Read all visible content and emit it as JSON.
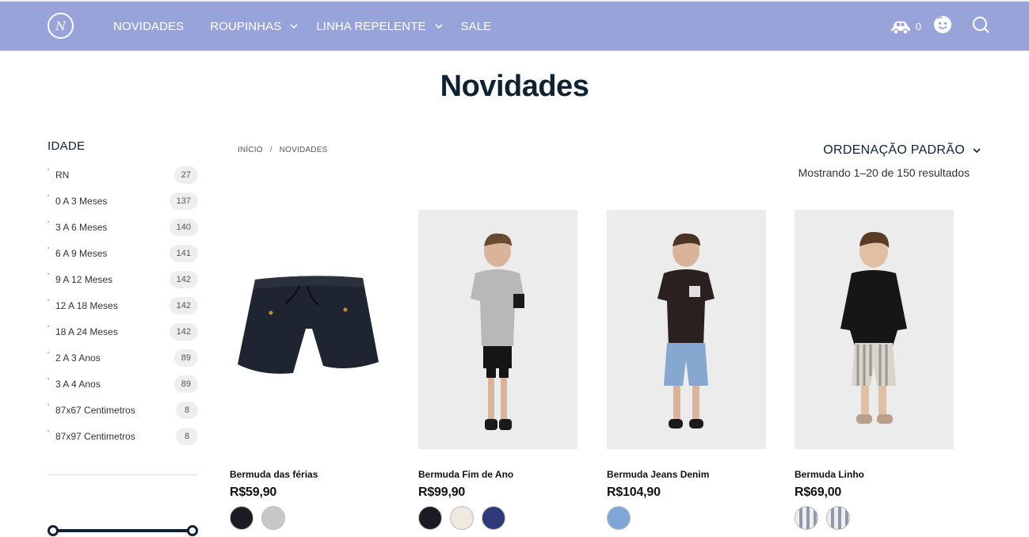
{
  "header": {
    "logo_text": "N",
    "nav": [
      {
        "label": "NOVIDADES",
        "has_dropdown": false
      },
      {
        "label": "ROUPINHAS",
        "has_dropdown": true
      },
      {
        "label": "LINHA REPELENTE",
        "has_dropdown": true
      },
      {
        "label": "SALE",
        "has_dropdown": false
      }
    ],
    "cart_count": "0",
    "colors": {
      "bar": "#98a3d9",
      "text": "#ffffff"
    }
  },
  "page": {
    "title": "Novidades"
  },
  "breadcrumb": {
    "home": "INÍCIO",
    "separator": "/",
    "current": "NOVIDADES"
  },
  "ordering": {
    "label": "ORDENAÇÃO PADRÃO"
  },
  "result_count": "Mostrando 1–20 de 150 resultados",
  "sidebar": {
    "filter_title": "IDADE",
    "items": [
      {
        "label": "RN",
        "count": "27"
      },
      {
        "label": "0 A 3 Meses",
        "count": "137"
      },
      {
        "label": "3 A 6 Meses",
        "count": "140"
      },
      {
        "label": "6 A 9 Meses",
        "count": "141"
      },
      {
        "label": "9 A 12 Meses",
        "count": "142"
      },
      {
        "label": "12 A 18 Meses",
        "count": "142"
      },
      {
        "label": "18 A 24 Meses",
        "count": "142"
      },
      {
        "label": "2 A 3 Anos",
        "count": "89"
      },
      {
        "label": "3 A 4 Anos",
        "count": "89"
      },
      {
        "label": "87x67 Centimetros",
        "count": "8"
      },
      {
        "label": "87x97 Centimetros",
        "count": "8"
      }
    ]
  },
  "products": [
    {
      "name": "Bermuda das férias",
      "price": "R$59,90",
      "swatches": [
        "#1c1b24",
        "#c8c8c8"
      ]
    },
    {
      "name": "Bermuda Fim de Ano",
      "price": "R$99,90",
      "swatches": [
        "#1c1b24",
        "#efe9df",
        "#2e3a78"
      ]
    },
    {
      "name": "Bermuda Jeans Denim",
      "price": "R$104,90",
      "swatches": [
        "#7fa6d6"
      ]
    },
    {
      "name": "Bermuda Linho",
      "price": "R$69,00",
      "swatches": [
        "striped",
        "striped"
      ]
    }
  ]
}
